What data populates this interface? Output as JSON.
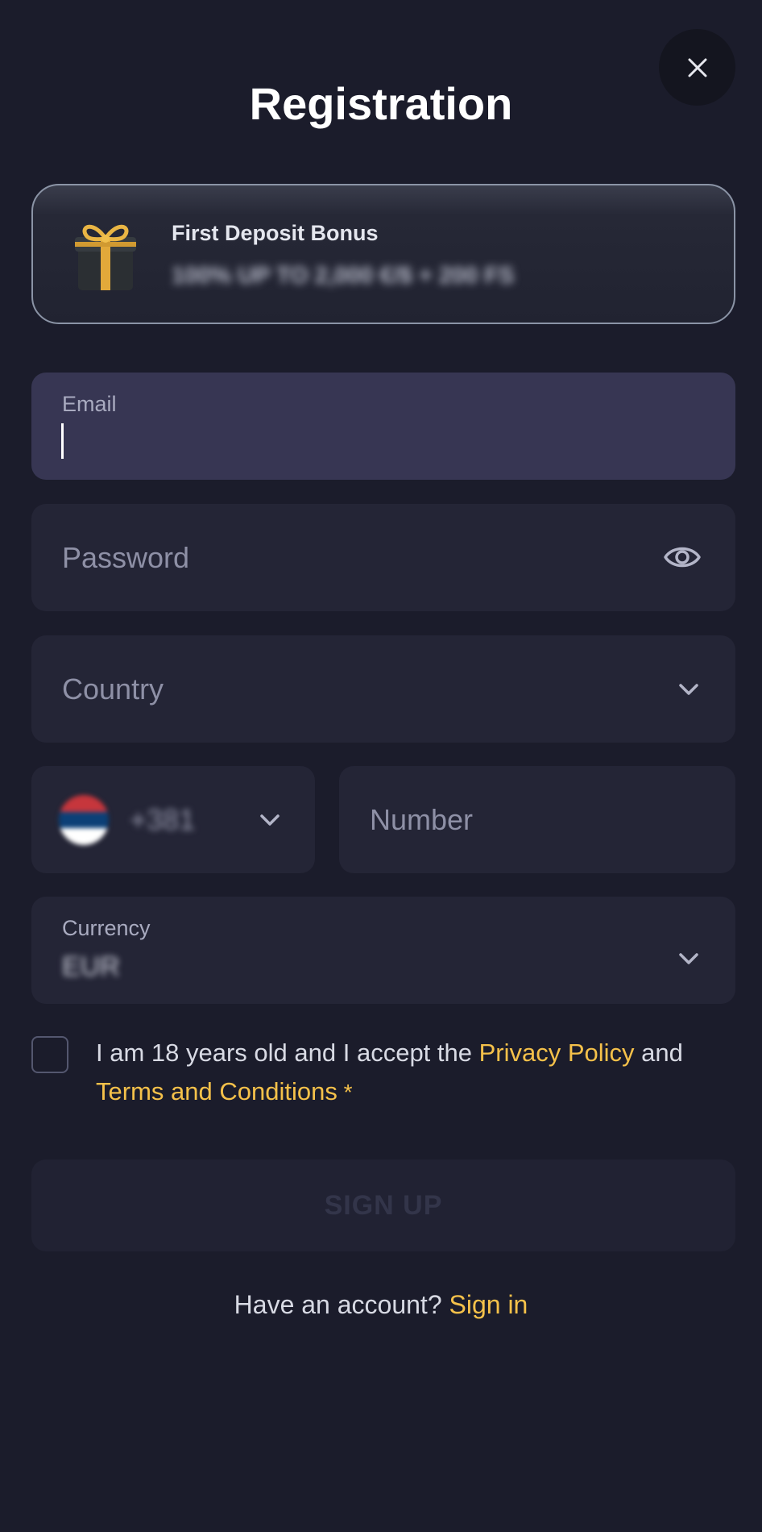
{
  "modal": {
    "title": "Registration"
  },
  "bonus": {
    "title": "First Deposit Bonus",
    "amount": "100% UP TO 2,000 €/$ + 200 FS"
  },
  "form": {
    "email_label": "Email",
    "password_placeholder": "Password",
    "country_placeholder": "Country",
    "phone_code": "+381",
    "number_placeholder": "Number",
    "currency_label": "Currency",
    "currency_value": "EUR"
  },
  "consent": {
    "text_before": "I am 18 years old and I accept the ",
    "privacy_link": "Privacy Policy",
    "text_and": " and ",
    "terms_link": "Terms and Conditions",
    "required_mark": " *"
  },
  "actions": {
    "signup_label": "SIGN UP",
    "have_account_text": "Have an account? ",
    "signin_link": "Sign in"
  },
  "colors": {
    "background": "#1b1c2b",
    "field": "#242536",
    "field_focused": "#373653",
    "accent": "#f5c14a"
  },
  "icons": {
    "close": "close-icon",
    "gift": "gift-icon",
    "eye": "eye-icon",
    "chevron": "chevron-down-icon",
    "flag": "serbia-flag-icon"
  }
}
